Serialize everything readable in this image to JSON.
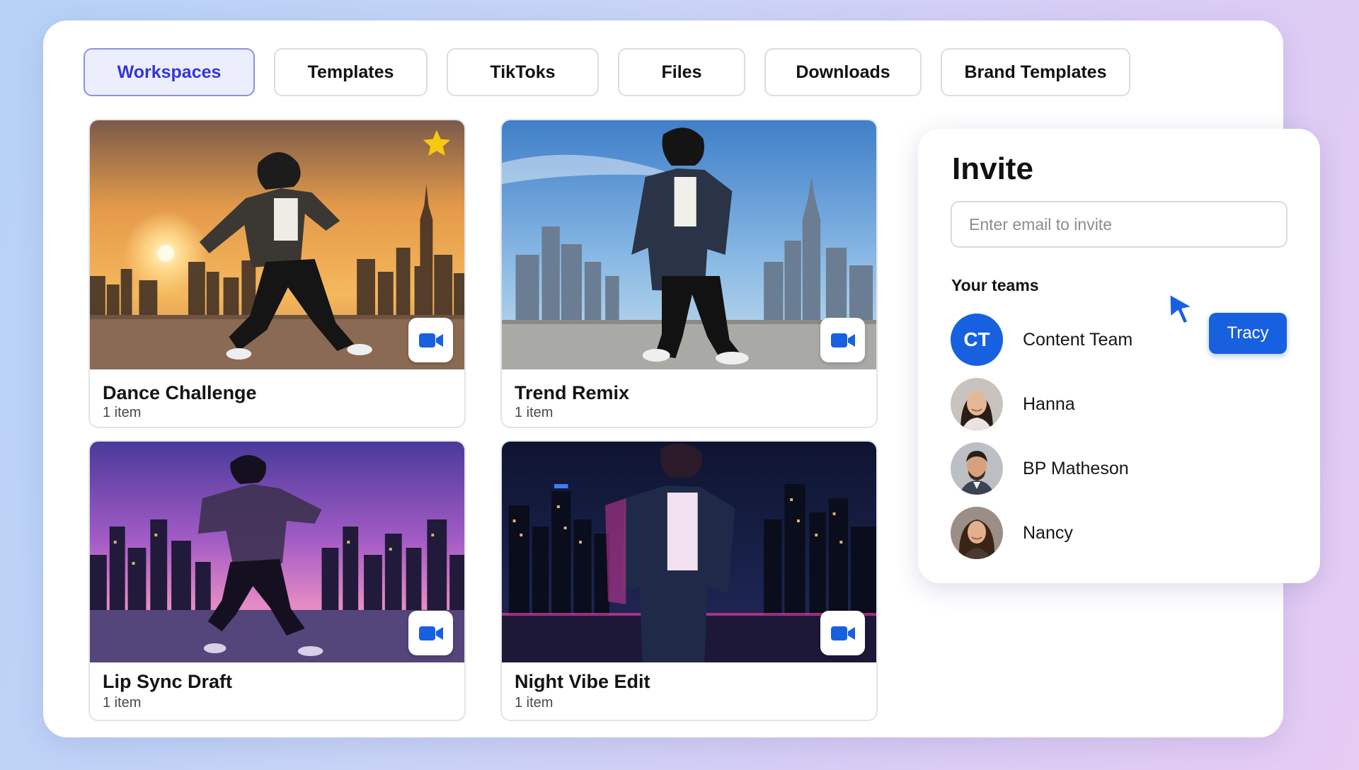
{
  "tabs": [
    {
      "label": "Workspaces",
      "active": true
    },
    {
      "label": "Templates"
    },
    {
      "label": "TikToks"
    },
    {
      "label": "Files"
    },
    {
      "label": "Downloads"
    },
    {
      "label": "Brand Templates"
    }
  ],
  "cards": [
    {
      "title": "Dance Challenge",
      "subtitle": "1 item",
      "starred": true,
      "icon": "video-camera-icon"
    },
    {
      "title": "Trend Remix",
      "subtitle": "1 item",
      "icon": "video-camera-icon"
    },
    {
      "title": "Lip Sync Draft",
      "subtitle": "1 item",
      "icon": "video-camera-icon"
    },
    {
      "title": "Night Vibe Edit",
      "subtitle": "1 item",
      "icon": "video-camera-icon"
    }
  ],
  "invite": {
    "title": "Invite",
    "placeholder": "Enter email to invite",
    "teams_label": "Your teams",
    "members": [
      {
        "name": "Content Team",
        "initials": "CT"
      },
      {
        "name": "Hanna"
      },
      {
        "name": "BP Matheson"
      },
      {
        "name": "Nancy"
      }
    ],
    "tooltip_button": "Tracy"
  },
  "colors": {
    "accent": "#1760e0",
    "active_tab_bg": "#eceefc",
    "active_tab_text": "#3535d6",
    "star": "#f6c90e"
  }
}
